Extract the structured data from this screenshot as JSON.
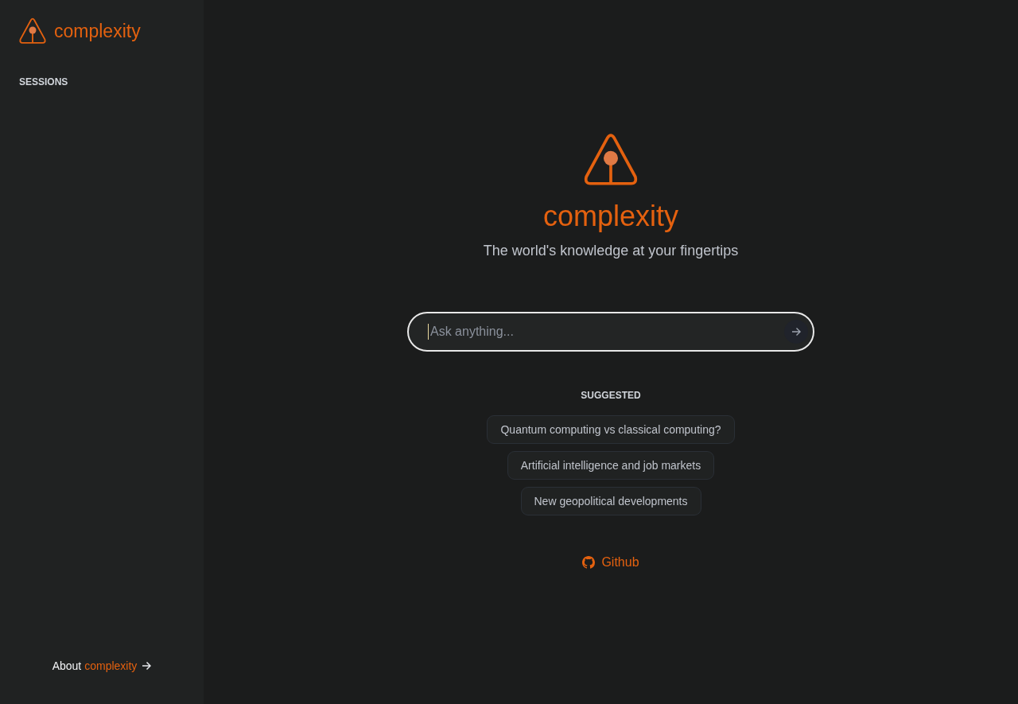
{
  "sidebar": {
    "brand": "complexity",
    "section_title": "SESSIONS",
    "about": {
      "label": "About",
      "brand": "complexity"
    }
  },
  "hero": {
    "title": "complexity",
    "tagline": "The world's knowledge at your fingertips"
  },
  "search": {
    "placeholder": "Ask anything..."
  },
  "suggested": {
    "title": "SUGGESTED",
    "items": [
      {
        "label": "Quantum computing vs classical computing?"
      },
      {
        "label": "Artificial intelligence and job markets"
      },
      {
        "label": "New geopolitical developments"
      }
    ]
  },
  "github_link": "Github"
}
